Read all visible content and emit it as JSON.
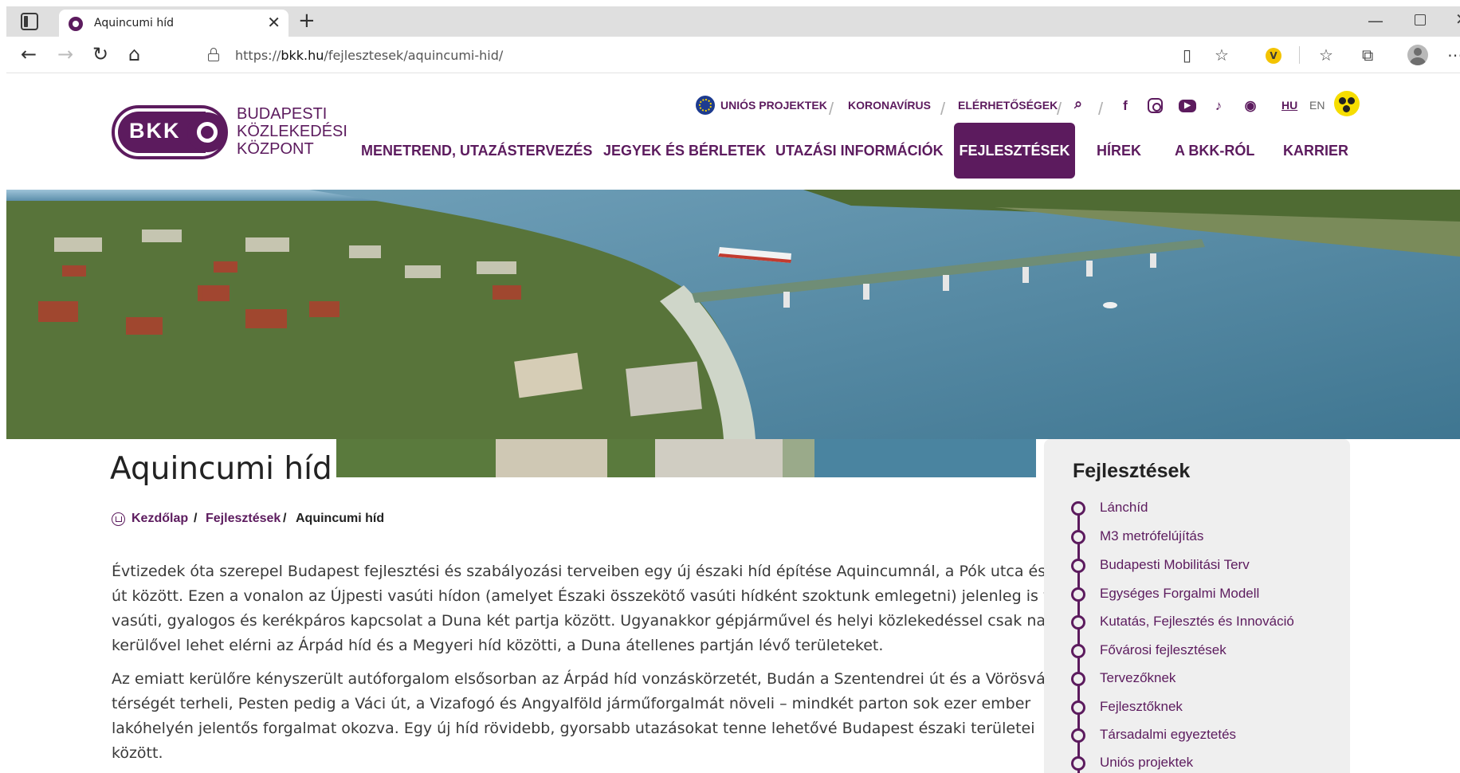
{
  "browser": {
    "tab_title": "Aquincumi híd",
    "url_prefix": "https://",
    "url_host": "bkk.hu",
    "url_path": "/fejlesztesek/aquincumi-hid/"
  },
  "header": {
    "logo_mark": "BKK",
    "logo_line1": "BUDAPESTI",
    "logo_line2": "KÖZLEKEDÉSI",
    "logo_line3": "KÖZPONT",
    "top_links": {
      "unios": "UNIÓS PROJEKTEK",
      "koronavirus": "KORONAVÍRUS",
      "elerhetosegek": "ELÉRHETŐSÉGEK"
    },
    "lang_hu": "HU",
    "lang_en": "EN",
    "nav": [
      "MENETREND, UTAZÁSTERVEZÉS",
      "JEGYEK ÉS BÉRLETEK",
      "UTAZÁSI INFORMÁCIÓK",
      "FEJLESZTÉSEK",
      "HÍREK",
      "A BKK-RÓL",
      "KARRIER"
    ]
  },
  "colors": {
    "brand": "#5c1b5e",
    "accessibility": "#f6dd00",
    "sidebar_bg": "#efefef"
  },
  "content": {
    "title": "Aquincumi híd",
    "breadcrumb": {
      "home": "Kezdőlap",
      "section": "Fejlesztések",
      "current": "Aquincumi híd",
      "separator": "/"
    },
    "paragraph1": [
      "Évtizedek óta szerepel Budapest fejlesztési és szabályozási terveiben egy új északi híd építése Aquincumnál, a Pók utca és a Váci",
      "út között. Ezen a vonalon az Újpesti vasúti hídon (amelyet Északi összekötő vasúti hídként szoktunk emlegetni) jelenleg is van",
      "vasúti, gyalogos és kerékpáros kapcsolat a Duna két partja között. Ugyanakkor gépjárművel és helyi közlekedéssel csak nagy",
      "kerülővel lehet elérni az Árpád híd és a Megyeri híd közötti, a Duna átellenes partján lévő területeket."
    ],
    "paragraph2": [
      "Az emiatt kerülőre kényszerült autóforgalom elsősorban az Árpád híd vonzáskörzetét, Budán a Szentendrei út és a Vörösvári út",
      "térségét terheli, Pesten pedig a Váci út, a Vizafogó és Angyalföld járműforgalmát növeli – mindkét parton sok ezer ember",
      "lakóhelyén jelentős forgalmat okozva. Egy új híd rövidebb, gyorsabb utazásokat tenne lehetővé Budapest északi területei",
      "között."
    ]
  },
  "sidebar": {
    "title": "Fejlesztések",
    "items": [
      "Lánchíd",
      "M3 metrófelújítás",
      "Budapesti Mobilitási Terv",
      "Egységes Forgalmi Modell",
      "Kutatás, Fejlesztés és Innováció",
      "Fővárosi fejlesztések",
      "Tervezőknek",
      "Fejlesztőknek",
      "Társadalmi egyeztetés",
      "Uniós projektek"
    ]
  }
}
